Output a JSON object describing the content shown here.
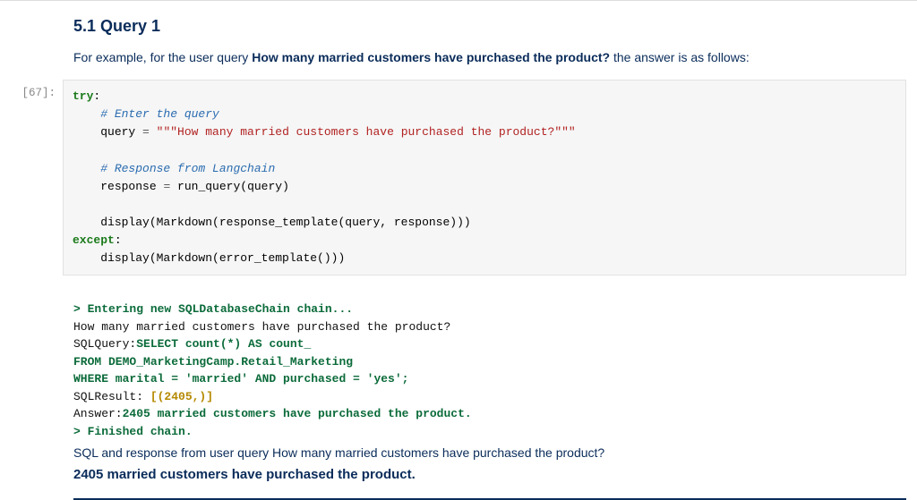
{
  "heading": "5.1 Query 1",
  "intro_prefix": "For example, for the user query ",
  "intro_bold": "How many married customers have purchased the product?",
  "intro_suffix": " the answer is as follows:",
  "cell": {
    "prompt": "[67]:",
    "code": {
      "l1_kw": "try",
      "l1_colon": ":",
      "l2": "# Enter the query",
      "l3a": "query ",
      "l3b": "=",
      "l3c": " \"\"\"How many married customers have purchased the product?\"\"\"",
      "l5": "# Response from Langchain",
      "l6a": "response ",
      "l6b": "=",
      "l6c": " run_query(query)",
      "l8": "display(Markdown(response_template(query, response)))",
      "l9_kw": "except",
      "l9_colon": ":",
      "l10": "display(Markdown(error_template()))"
    }
  },
  "output": {
    "o1": "> Entering new SQLDatabaseChain chain...",
    "o2": "How many married customers have purchased the product?",
    "o3a": "SQLQuery:",
    "o3b": "SELECT count(*) AS count_",
    "o4": "FROM DEMO_MarketingCamp.Retail_Marketing",
    "o5": "WHERE marital = 'married' AND purchased = 'yes';",
    "o6a": "SQLResult: ",
    "o6b": "[(2405,)]",
    "o7a": "Answer:",
    "o7b": "2405 married customers have purchased the product.",
    "o8": "> Finished chain.",
    "md1": "SQL and response from user query How many married customers have purchased the product?",
    "md2": "2405 married customers have purchased the product."
  }
}
